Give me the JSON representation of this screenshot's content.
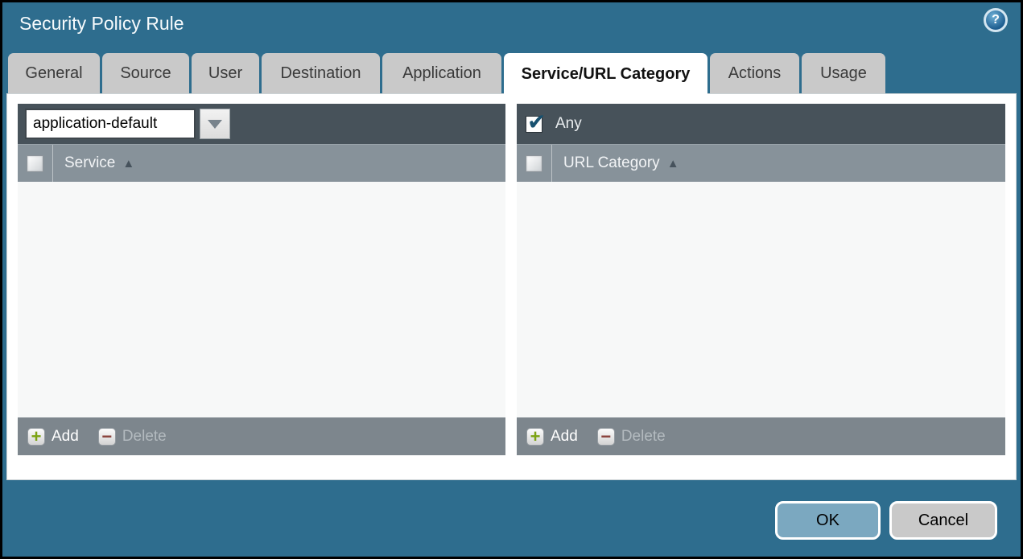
{
  "window": {
    "title": "Security Policy Rule",
    "help_glyph": "?"
  },
  "tabs": [
    {
      "label": "General",
      "active": false
    },
    {
      "label": "Source",
      "active": false
    },
    {
      "label": "User",
      "active": false
    },
    {
      "label": "Destination",
      "active": false
    },
    {
      "label": "Application",
      "active": false
    },
    {
      "label": "Service/URL Category",
      "active": true
    },
    {
      "label": "Actions",
      "active": false
    },
    {
      "label": "Usage",
      "active": false
    }
  ],
  "service_panel": {
    "dropdown_value": "application-default",
    "column_header": "Service",
    "sort_indicator": "▲",
    "header_checkbox_checked": false,
    "rows": [],
    "add_label": "Add",
    "delete_label": "Delete",
    "delete_enabled": false
  },
  "url_category_panel": {
    "any_label": "Any",
    "any_checked": true,
    "column_header": "URL Category",
    "sort_indicator": "▲",
    "header_checkbox_checked": false,
    "rows": [],
    "add_label": "Add",
    "delete_label": "Delete",
    "delete_enabled": false
  },
  "dialog_buttons": {
    "ok_label": "OK",
    "cancel_label": "Cancel"
  },
  "colors": {
    "dialog_background": "#2E6D8E",
    "panel_header_bar": "#47525A",
    "column_header_bar": "#87929A",
    "panel_footer_bar": "#7D868D",
    "tab_inactive": "#C9C9C9",
    "tab_active": "#FFFFFF",
    "ok_button": "#7BA8C0",
    "cancel_button": "#C9C9C9",
    "add_plus": "#7CA312",
    "delete_minus": "#8A423C",
    "any_checkmark": "#17506F"
  }
}
